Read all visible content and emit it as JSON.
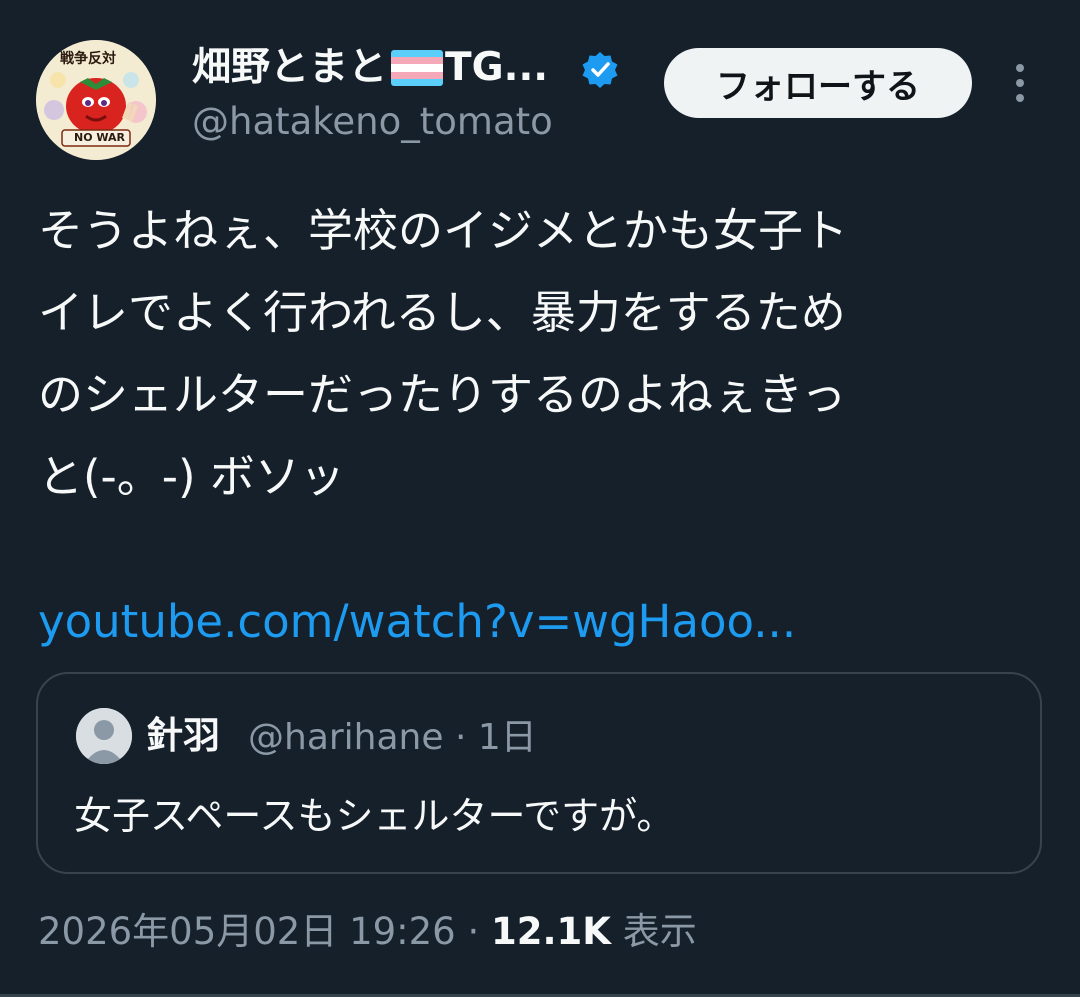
{
  "author": {
    "display_name": "畑野とまと",
    "display_suffix": "TG...",
    "handle": "@hatakeno_tomato",
    "avatar_badge_top": "戦争反対",
    "avatar_badge_bottom": "NO WAR"
  },
  "actions": {
    "follow_label": "フォローする"
  },
  "tweet": {
    "lines": [
      "そうよねぇ、学校のイジメとかも女子ト",
      "イレでよく行われるし、暴力をするため",
      "のシェルターだったりするのよねぇきっ",
      "と(-。-) ボソッ"
    ],
    "link": "youtube.com/watch?v=wgHaoo..."
  },
  "quote": {
    "name": "針羽",
    "handle": "@harihane",
    "time": "· 1日",
    "text": "女子スペースもシェルターですが。"
  },
  "meta": {
    "timestamp": "2026年05月02日 19:26",
    "separator": "·",
    "views_count": "12.1K",
    "views_label": "表示"
  },
  "colors": {
    "background": "#15202b",
    "link": "#1d9bf0",
    "muted": "#8b98a5",
    "text": "#f7f9f9",
    "border": "#38444d"
  }
}
